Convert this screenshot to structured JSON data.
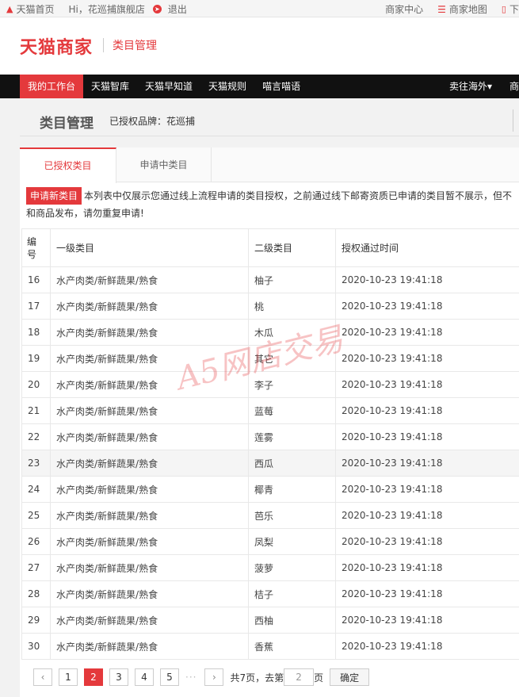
{
  "topbar": {
    "home": "天猫首页",
    "greeting": "Hi，花巡捕旗舰店",
    "logout": "退出",
    "merchant_center": "商家中心",
    "merchant_map": "商家地图",
    "download": "下"
  },
  "header": {
    "logo": "天猫商家",
    "title": "类目管理"
  },
  "nav": {
    "items": [
      "我的工作台",
      "天猫智库",
      "天猫早知道",
      "天猫规则",
      "喵言喵语"
    ],
    "right_items": [
      "卖往海外",
      "商"
    ]
  },
  "page": {
    "title": "类目管理",
    "brand_label": "已授权品牌：花巡捕"
  },
  "tabs": [
    "已授权类目",
    "申请中类目"
  ],
  "notice": {
    "apply_button": "申请新类目",
    "text": "本列表中仅展示您通过线上流程申请的类目授权，之前通过线下邮寄资质已申请的类目暂不展示，但不",
    "text2": "和商品发布，请勿重复申请!"
  },
  "table": {
    "headers": [
      "编号",
      "一级类目",
      "二级类目",
      "授权通过时间"
    ],
    "rows": [
      [
        "16",
        "水产肉类/新鲜蔬果/熟食",
        "柚子",
        "2020-10-23 19:41:18"
      ],
      [
        "17",
        "水产肉类/新鲜蔬果/熟食",
        "桃",
        "2020-10-23 19:41:18"
      ],
      [
        "18",
        "水产肉类/新鲜蔬果/熟食",
        "木瓜",
        "2020-10-23 19:41:18"
      ],
      [
        "19",
        "水产肉类/新鲜蔬果/熟食",
        "其它",
        "2020-10-23 19:41:18"
      ],
      [
        "20",
        "水产肉类/新鲜蔬果/熟食",
        "李子",
        "2020-10-23 19:41:18"
      ],
      [
        "21",
        "水产肉类/新鲜蔬果/熟食",
        "蓝莓",
        "2020-10-23 19:41:18"
      ],
      [
        "22",
        "水产肉类/新鲜蔬果/熟食",
        "莲雾",
        "2020-10-23 19:41:18"
      ],
      [
        "23",
        "水产肉类/新鲜蔬果/熟食",
        "西瓜",
        "2020-10-23 19:41:18"
      ],
      [
        "24",
        "水产肉类/新鲜蔬果/熟食",
        "椰青",
        "2020-10-23 19:41:18"
      ],
      [
        "25",
        "水产肉类/新鲜蔬果/熟食",
        "芭乐",
        "2020-10-23 19:41:18"
      ],
      [
        "26",
        "水产肉类/新鲜蔬果/熟食",
        "凤梨",
        "2020-10-23 19:41:18"
      ],
      [
        "27",
        "水产肉类/新鲜蔬果/熟食",
        "菠萝",
        "2020-10-23 19:41:18"
      ],
      [
        "28",
        "水产肉类/新鲜蔬果/熟食",
        "桔子",
        "2020-10-23 19:41:18"
      ],
      [
        "29",
        "水产肉类/新鲜蔬果/熟食",
        "西柚",
        "2020-10-23 19:41:18"
      ],
      [
        "30",
        "水产肉类/新鲜蔬果/熟食",
        "香蕉",
        "2020-10-23 19:41:18"
      ]
    ],
    "highlighted_row": "23"
  },
  "pager": {
    "prev": "‹",
    "next": "›",
    "pages": [
      "1",
      "2",
      "3",
      "4",
      "5"
    ],
    "current": "2",
    "ellipsis": "···",
    "total_text": "共7页，去第",
    "input_value": "2",
    "page_suffix": "页",
    "confirm": "确定"
  },
  "watermark": "A5网店交易",
  "colors": {
    "accent": "#e4393c",
    "nav_bg": "#111111"
  }
}
